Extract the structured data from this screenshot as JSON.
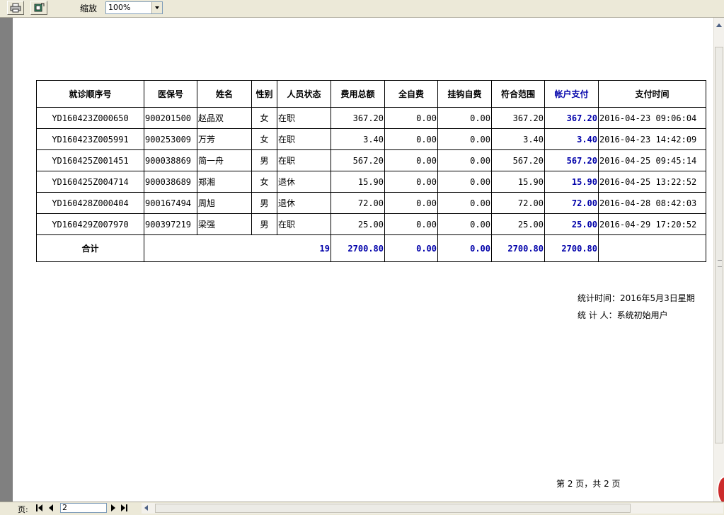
{
  "toolbar": {
    "print_icon": "printer-icon",
    "export_icon": "export-icon",
    "zoom_label": "缩放",
    "zoom_value": "100%"
  },
  "table": {
    "headers": [
      "就诊顺序号",
      "医保号",
      "姓名",
      "性别",
      "人员状态",
      "费用总额",
      "全自费",
      "挂钩自费",
      "符合范围",
      "帐户支付",
      "支付时间"
    ],
    "rows": [
      [
        "YD160423Z000650",
        "900201500",
        "赵品双",
        "女",
        "在职",
        "367.20",
        "0.00",
        "0.00",
        "367.20",
        "367.20",
        "2016-04-23 09:06:04"
      ],
      [
        "YD160423Z005991",
        "900253009",
        "万芳",
        "女",
        "在职",
        "3.40",
        "0.00",
        "0.00",
        "3.40",
        "3.40",
        "2016-04-23 14:42:09"
      ],
      [
        "YD160425Z001451",
        "900038869",
        "简一舟",
        "男",
        "在职",
        "567.20",
        "0.00",
        "0.00",
        "567.20",
        "567.20",
        "2016-04-25 09:45:14"
      ],
      [
        "YD160425Z004714",
        "900038689",
        "郑湘",
        "女",
        "退休",
        "15.90",
        "0.00",
        "0.00",
        "15.90",
        "15.90",
        "2016-04-25 13:22:52"
      ],
      [
        "YD160428Z000404",
        "900167494",
        "周旭",
        "男",
        "退休",
        "72.00",
        "0.00",
        "0.00",
        "72.00",
        "72.00",
        "2016-04-28 08:42:03"
      ],
      [
        "YD160429Z007970",
        "900397219",
        "梁强",
        "男",
        "在职",
        "25.00",
        "0.00",
        "0.00",
        "25.00",
        "25.00",
        "2016-04-29 17:20:52"
      ]
    ],
    "total": {
      "label": "合计",
      "count": "19",
      "total_fee": "2700.80",
      "self_pay": "0.00",
      "hook_self_pay": "0.00",
      "in_scope": "2700.80",
      "account_pay": "2700.80"
    }
  },
  "footer": {
    "stat_time": "统计时间：2016年5月3日星期",
    "stat_person": "统 计 人：系统初始用户",
    "page_info": "第 2 页，共 2 页"
  },
  "statusbar": {
    "page_label": "页:",
    "page_value": "2"
  },
  "colors": {
    "highlight_blue": "#0000aa",
    "paper": "#ffffff",
    "chrome": "#ece9d8"
  }
}
